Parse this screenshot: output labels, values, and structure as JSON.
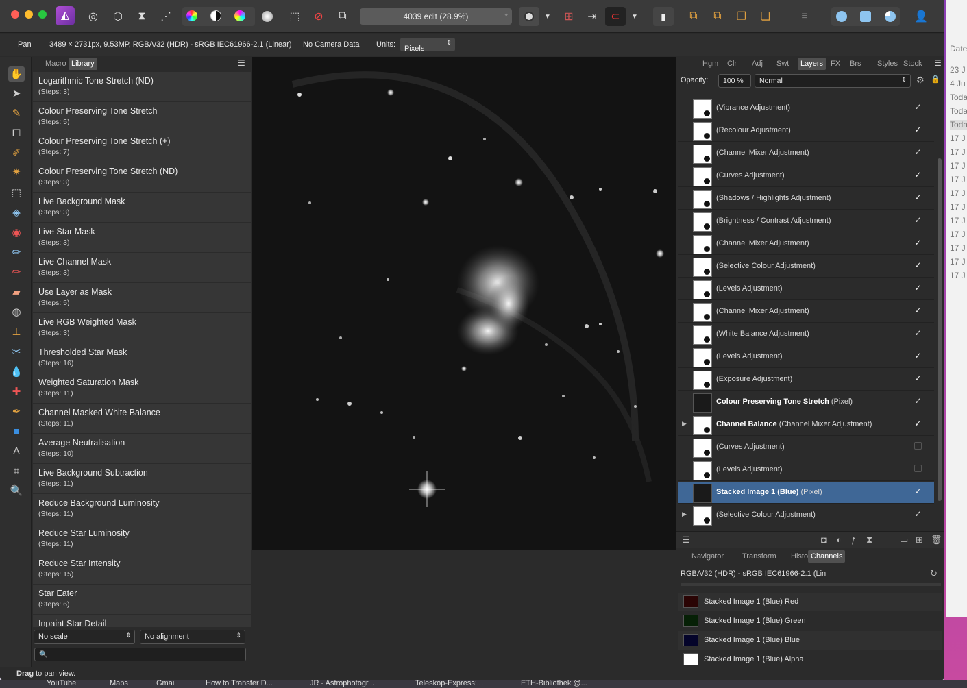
{
  "window": {
    "document_title": "4039 edit (28.9%)"
  },
  "context_bar": {
    "tool": "Pan",
    "doc_info": "3489 × 2731px, 9.53MP, RGBA/32 (HDR) - sRGB IEC61966-2.1 (Linear)",
    "camera": "No Camera Data",
    "units_label": "Units:",
    "units_value": "Pixels"
  },
  "left_panel": {
    "tabs": [
      "Macro",
      "Library"
    ],
    "active_tab": "Library",
    "macros": [
      {
        "name": "Logarithmic Tone Stretch (ND)",
        "steps": "(Steps: 3)"
      },
      {
        "name": "Colour Preserving Tone Stretch",
        "steps": "(Steps: 5)"
      },
      {
        "name": "Colour Preserving Tone Stretch (+)",
        "steps": "(Steps: 7)"
      },
      {
        "name": "Colour Preserving Tone Stretch (ND)",
        "steps": "(Steps: 3)"
      },
      {
        "name": "Live Background Mask",
        "steps": "(Steps: 3)"
      },
      {
        "name": "Live Star Mask",
        "steps": "(Steps: 3)"
      },
      {
        "name": "Live Channel Mask",
        "steps": "(Steps: 3)"
      },
      {
        "name": "Use Layer as Mask",
        "steps": "(Steps: 5)"
      },
      {
        "name": "Live RGB Weighted Mask",
        "steps": "(Steps: 3)"
      },
      {
        "name": "Thresholded Star Mask",
        "steps": "(Steps: 16)"
      },
      {
        "name": "Weighted Saturation Mask",
        "steps": "(Steps: 11)"
      },
      {
        "name": "Channel Masked White Balance",
        "steps": "(Steps: 11)"
      },
      {
        "name": "Average Neutralisation",
        "steps": "(Steps: 10)"
      },
      {
        "name": "Live Background Subtraction",
        "steps": "(Steps: 11)"
      },
      {
        "name": "Reduce Background Luminosity",
        "steps": "(Steps: 11)"
      },
      {
        "name": "Reduce Star Luminosity",
        "steps": "(Steps: 11)"
      },
      {
        "name": "Reduce Star Intensity",
        "steps": "(Steps: 15)"
      },
      {
        "name": "Star Eater",
        "steps": "(Steps: 6)"
      },
      {
        "name": "Inpaint Star Detail",
        "steps": ""
      }
    ],
    "scale_select": "No scale",
    "alignment_select": "No alignment"
  },
  "right_panel": {
    "tabs": [
      "Hgm",
      "Clr",
      "Adj",
      "Swt",
      "Layers",
      "FX",
      "Brs",
      "Styles",
      "Stock"
    ],
    "active_tab": "Layers",
    "opacity_label": "Opacity:",
    "opacity_value": "100 %",
    "blend_mode": "Normal",
    "layers": [
      {
        "bold": "",
        "name": "(Vibrance Adjustment)",
        "checked": true,
        "expand": false,
        "selected": false
      },
      {
        "bold": "",
        "name": "(Recolour Adjustment)",
        "checked": true,
        "expand": false,
        "selected": false
      },
      {
        "bold": "",
        "name": "(Channel Mixer Adjustment)",
        "checked": true,
        "expand": false,
        "selected": false
      },
      {
        "bold": "",
        "name": "(Curves Adjustment)",
        "checked": true,
        "expand": false,
        "selected": false
      },
      {
        "bold": "",
        "name": "(Shadows / Highlights Adjustment)",
        "checked": true,
        "expand": false,
        "selected": false
      },
      {
        "bold": "",
        "name": "(Brightness / Contrast Adjustment)",
        "checked": true,
        "expand": false,
        "selected": false
      },
      {
        "bold": "",
        "name": "(Channel Mixer Adjustment)",
        "checked": true,
        "expand": false,
        "selected": false
      },
      {
        "bold": "",
        "name": "(Selective Colour Adjustment)",
        "checked": true,
        "expand": false,
        "selected": false
      },
      {
        "bold": "",
        "name": "(Levels Adjustment)",
        "checked": true,
        "expand": false,
        "selected": false
      },
      {
        "bold": "",
        "name": "(Channel Mixer Adjustment)",
        "checked": true,
        "expand": false,
        "selected": false
      },
      {
        "bold": "",
        "name": "(White Balance Adjustment)",
        "checked": true,
        "expand": false,
        "selected": false
      },
      {
        "bold": "",
        "name": "(Levels Adjustment)",
        "checked": true,
        "expand": false,
        "selected": false
      },
      {
        "bold": "",
        "name": "(Exposure Adjustment)",
        "checked": true,
        "expand": false,
        "selected": false
      },
      {
        "bold": "Colour Preserving Tone Stretch",
        "name": "(Pixel)",
        "checked": true,
        "expand": false,
        "selected": false,
        "dark": true
      },
      {
        "bold": "Channel Balance",
        "name": "(Channel Mixer Adjustment)",
        "checked": true,
        "expand": true,
        "selected": false
      },
      {
        "bold": "",
        "name": "(Curves Adjustment)",
        "checked": false,
        "expand": false,
        "selected": false
      },
      {
        "bold": "",
        "name": "(Levels Adjustment)",
        "checked": false,
        "expand": false,
        "selected": false
      },
      {
        "bold": "Stacked Image 1 (Blue)",
        "name": "(Pixel)",
        "checked": true,
        "expand": false,
        "selected": true,
        "dark": true
      },
      {
        "bold": "",
        "name": "(Selective Colour Adjustment)",
        "checked": true,
        "expand": true,
        "selected": false
      }
    ],
    "lower_tabs": [
      "Navigator",
      "Transform",
      "History",
      "Channels"
    ],
    "lower_active": "Channels",
    "color_profile": "RGBA/32 (HDR) - sRGB IEC61966-2.1 (Lin",
    "channels": [
      {
        "name": "Stacked Image 1 (Blue) Red",
        "color": "#2a0404"
      },
      {
        "name": "Stacked Image 1 (Blue) Green",
        "color": "#062006"
      },
      {
        "name": "Stacked Image 1 (Blue) Blue",
        "color": "#04042a"
      },
      {
        "name": "Stacked Image 1 (Blue) Alpha",
        "color": "#ffffff"
      }
    ]
  },
  "status": {
    "bold": "Drag",
    "text": " to pan view."
  },
  "behind_window": {
    "header": "Date",
    "rows": [
      "23 J",
      "4 Ju",
      "Toda",
      "Toda",
      "Toda",
      "17 J",
      "17 J",
      "17 J",
      "17 J",
      "17 J",
      "17 J",
      "17 J",
      "17 J",
      "17 J",
      "17 J",
      "17 J"
    ]
  },
  "bookmarks": [
    "YouTube",
    "Maps",
    "Gmail",
    "How to Transfer D...",
    "JR - Astrophotogr...",
    "Teleskop-Express:...",
    "ETH-Bibliothek @..."
  ],
  "colors": {
    "accent": "#3f6796",
    "canvas": "#101010",
    "panel": "#2b2b2b"
  }
}
